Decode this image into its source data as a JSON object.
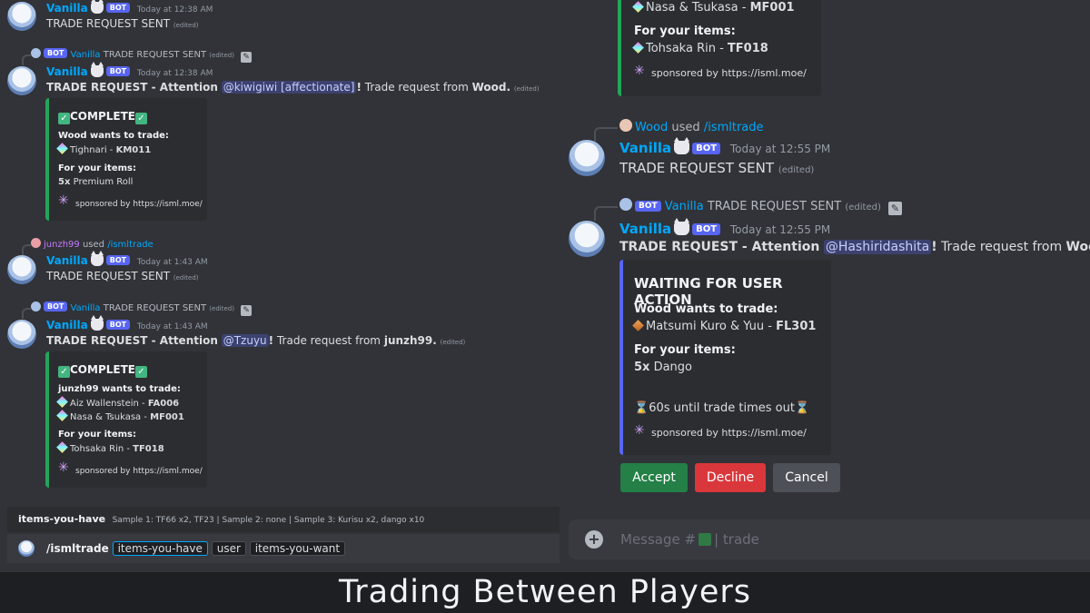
{
  "common": {
    "bot_name": "Vanilla",
    "bot_tag": "BOT",
    "edited": "(edited)",
    "trade_sent": "TRADE REQUEST SENT",
    "sponsored": "sponsored by https://isml.moe/",
    "wood_wants": "Wood wants to trade:",
    "for_items": "For your items:",
    "complete": "COMPLETE",
    "attention_prefix": "TRADE REQUEST - Attention",
    "trade_from": "Trade request from",
    "command": "/ismltrade",
    "used": "used"
  },
  "left": {
    "m1": {
      "time": "Today at 12:38 AM"
    },
    "m2": {
      "time": "Today at 12:38 AM",
      "mention": "@kiwigiwi [affectionate]",
      "from_user": "Wood.",
      "wood_item_name": "Tighnari - ",
      "wood_item_code": "KM011",
      "your_qty": "5x",
      "your_item": "Premium Roll"
    },
    "m3": {
      "user": "junzh99",
      "time": "Today at 1:43 AM"
    },
    "m4": {
      "time": "Today at 1:43 AM",
      "mention": "@Tzuyu",
      "from_user": "junzh99.",
      "wants": "junzh99 wants to trade:",
      "item1_name": "Aiz Wallenstein - ",
      "item1_code": "FA006",
      "item2_name": "Nasa & Tsukasa - ",
      "item2_code": "MF001",
      "your_item_name": "Tohsaka Rin - ",
      "your_item_code": "TF018"
    },
    "cmd_hint": {
      "label": "items-you-have",
      "text": "Sample 1: TF66 x2, TF23 | Sample 2: none | Sample 3: Kurisu x2, dango x10"
    },
    "cmd_opts": [
      "items-you-have",
      "user",
      "items-you-want"
    ]
  },
  "right": {
    "top_item_name": "Nasa & Tsukasa - ",
    "top_item_code": "MF001",
    "top_your_name": "Tohsaka Rin - ",
    "top_your_code": "TF018",
    "m5": {
      "user": "Wood",
      "time": "Today at 12:55 PM"
    },
    "m6": {
      "time": "Today at 12:55 PM",
      "mention": "@Hashiridashita",
      "from_user": "Wood.",
      "status": "WAITING FOR USER ACTION",
      "wood_item_name": "Matsumi Kuro & Yuu - ",
      "wood_item_code": "FL301",
      "your_qty": "5x",
      "your_item": "Dango",
      "timer": "60s until trade times out"
    },
    "buttons": {
      "accept": "Accept",
      "decline": "Decline",
      "cancel": "Cancel"
    },
    "composer": {
      "placeholder_prefix": "Message #",
      "placeholder_suffix": "| trade"
    }
  },
  "caption": "Trading Between Players",
  "colors": {
    "accept": "#248046",
    "decline": "#da373c",
    "cancel": "#4e5058",
    "accent": "#5865f2",
    "complete": "#23a55a"
  }
}
